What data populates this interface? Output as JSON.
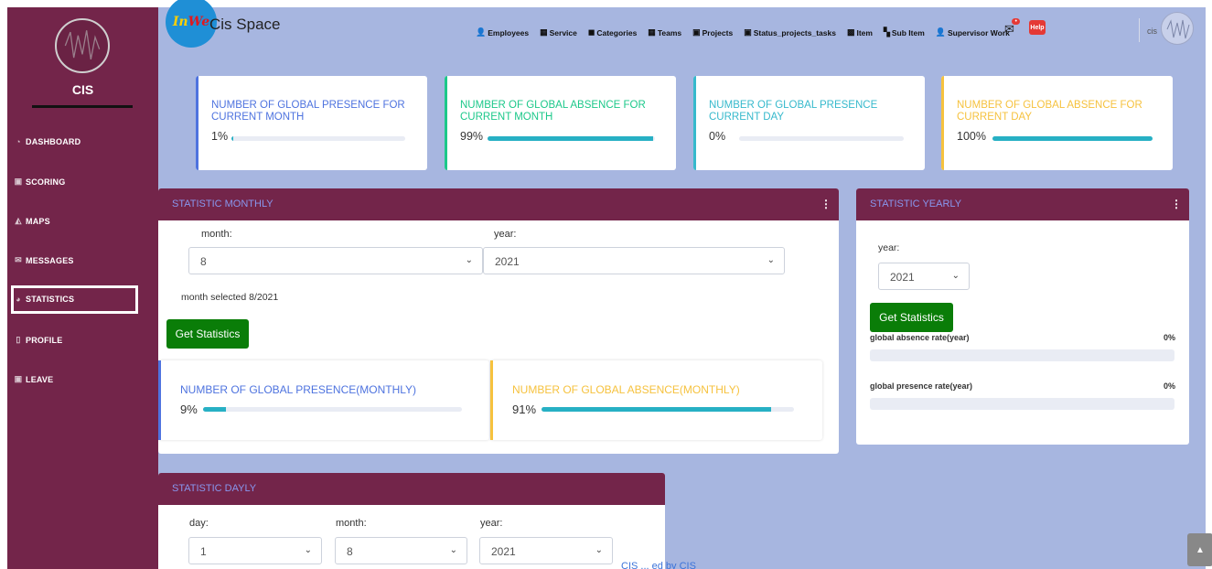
{
  "sidebar": {
    "brand": "CIS",
    "items": [
      {
        "label": "DASHBOARD",
        "icon": "dashboard-icon"
      },
      {
        "label": "SCORING",
        "icon": "briefcase-icon"
      },
      {
        "label": "MAPS",
        "icon": "map-icon"
      },
      {
        "label": "MESSAGES",
        "icon": "envelope-icon"
      },
      {
        "label": "STATISTICS",
        "icon": "chart-icon"
      },
      {
        "label": "PROFILE",
        "icon": "id-card-icon"
      },
      {
        "label": "LEAVE",
        "icon": "briefcase-icon"
      }
    ],
    "active_index": 4
  },
  "header": {
    "logo_text_a": "In",
    "logo_text_b": "We",
    "title": "Cis Space",
    "nav": [
      "Employees",
      "Service",
      "Categories",
      "Teams",
      "Projects",
      "Status_projects_tasks",
      "Item",
      "Sub Item",
      "Supervisor Work"
    ],
    "help_label": "Help",
    "user_name": "cis"
  },
  "kpis": [
    {
      "title": "NUMBER OF GLOBAL PRESENCE FOR CURRENT MONTH",
      "value": "1%",
      "percent": 1,
      "color": "#4e73df"
    },
    {
      "title": "NUMBER OF GLOBAL ABSENCE FOR CURRENT MONTH",
      "value": "99%",
      "percent": 99,
      "color": "#1cc88a"
    },
    {
      "title": "NUMBER OF GLOBAL PRESENCE CURRENT DAY",
      "value": "0%",
      "percent": 0,
      "color": "#36b9cc"
    },
    {
      "title": "NUMBER OF GLOBAL ABSENCE FOR CURRENT DAY",
      "value": "100%",
      "percent": 100,
      "color": "#f6c23e"
    }
  ],
  "monthly": {
    "title": "STATISTIC MONTHLY",
    "month_label": "month:",
    "month_value": "8",
    "year_label": "year:",
    "year_value": "2021",
    "selected_text": "month selected 8/2021",
    "button": "Get Statistics",
    "presence": {
      "title": "NUMBER OF GLOBAL PRESENCE(MONTHLY)",
      "value": "9%",
      "percent": 9,
      "color": "#4e73df"
    },
    "absence": {
      "title": "NUMBER OF GLOBAL ABSENCE(MONTHLY)",
      "value": "91%",
      "percent": 91,
      "color": "#f6c23e"
    }
  },
  "yearly": {
    "title": "STATISTIC YEARLY",
    "year_label": "year:",
    "year_value": "2021",
    "button": "Get Statistics",
    "absence_label": "global absence rate(year)",
    "absence_value": "0%",
    "absence_percent": 0,
    "presence_label": "global presence rate(year)",
    "presence_value": "0%",
    "presence_percent": 0
  },
  "daily": {
    "title": "STATISTIC DAYLY",
    "day_label": "day:",
    "day_value": "1",
    "month_label": "month:",
    "month_value": "8",
    "year_label": "year:",
    "year_value": "2021"
  },
  "footer": {
    "text": "CIS ... ed by CIS"
  },
  "colors": {
    "sidebar": "#73254a",
    "accent": "#27b0c4",
    "green": "#0a7d08",
    "background": "#a7b6e0"
  }
}
